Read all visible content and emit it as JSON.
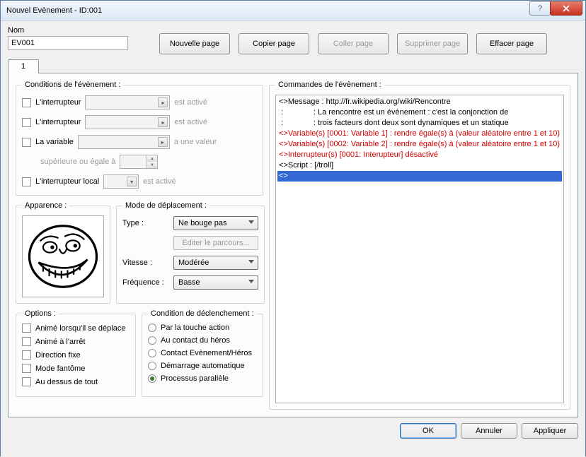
{
  "window": {
    "title": "Nouvel Evènement - ID:001"
  },
  "name": {
    "label": "Nom",
    "value": "EV001"
  },
  "page_buttons": {
    "new": "Nouvelle page",
    "copy": "Copier page",
    "paste": "Coller page",
    "delete": "Supprimer page",
    "clear": "Effacer page"
  },
  "tabs": [
    "1"
  ],
  "conditions": {
    "legend": "Conditions de l'évènement :",
    "rows": [
      {
        "label": "L'interrupteur",
        "trail": "est activé"
      },
      {
        "label": "L'interrupteur",
        "trail": "est activé"
      },
      {
        "label": "La variable",
        "trail": "a une valeur"
      }
    ],
    "sup_label": "supérieure ou égale à",
    "local_label": "L'interrupteur local",
    "local_trail": "est activé"
  },
  "appearance": {
    "legend": "Apparence :"
  },
  "movement": {
    "legend": "Mode de déplacement :",
    "type_label": "Type :",
    "type_value": "Ne bouge pas",
    "edit_route": "Editer le parcours...",
    "speed_label": "Vitesse :",
    "speed_value": "Modérée",
    "freq_label": "Fréquence :",
    "freq_value": "Basse"
  },
  "options": {
    "legend": "Options :",
    "items": [
      "Animé lorsqu'il se déplace",
      "Animé à l'arrêt",
      "Direction fixe",
      "Mode fantôme",
      "Au dessus de tout"
    ]
  },
  "trigger": {
    "legend": "Condition de déclenchement :",
    "items": [
      "Par la touche action",
      "Au contact du héros",
      "Contact Evènement/Héros",
      "Démarrage automatique",
      "Processus parallèle"
    ],
    "selected": 4
  },
  "commands": {
    "legend": "Commandes de l'évènement :",
    "lines": [
      {
        "kind": "plain",
        "text": "<>Message : http://fr.wikipedia.org/wiki/Rencontre"
      },
      {
        "kind": "plain",
        "text": " :              : La rencontre est un évènement : c'est la conjonction de"
      },
      {
        "kind": "plain",
        "text": " :              : trois facteurs dont deux sont dynamiques et un statique"
      },
      {
        "kind": "red",
        "text": "<>Variable(s) [0001: Variable 1] : rendre égale(s) à (valeur aléatoire entre 1 et 10)"
      },
      {
        "kind": "red",
        "text": "<>Variable(s) [0002: Variable 2] : rendre égale(s) à (valeur aléatoire entre 1 et 10)"
      },
      {
        "kind": "red",
        "text": "<>Interrupteur(s) [0001: Interupteur] désactivé"
      },
      {
        "kind": "plain",
        "text": "<>Script : [/troll]"
      },
      {
        "kind": "sel",
        "text": "<>"
      }
    ]
  },
  "dialog_buttons": {
    "ok": "OK",
    "cancel": "Annuler",
    "apply": "Appliquer"
  }
}
